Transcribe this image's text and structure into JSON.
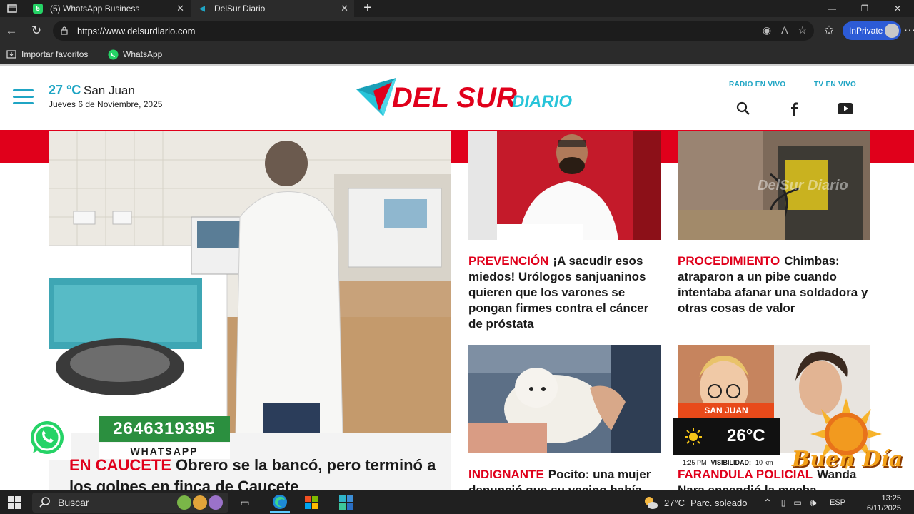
{
  "browser": {
    "tabs": [
      {
        "label": "(5) WhatsApp Business",
        "active": false
      },
      {
        "label": "DelSur Diario",
        "active": true
      }
    ],
    "new_tab": "+",
    "url": "https://www.delsurdiario.com",
    "inprivate_label": "InPrivate",
    "favorites": [
      {
        "label": "Importar favoritos",
        "icon": "import-icon"
      },
      {
        "label": "WhatsApp",
        "icon": "whatsapp-icon"
      }
    ]
  },
  "site": {
    "weather": {
      "temp": "27 °C",
      "city": "San Juan",
      "date": "Jueves 6 de Noviembre, 2025"
    },
    "logo": {
      "main": "DEL SUR",
      "sub": "DIARIO"
    },
    "links": {
      "radio": "RADIO EN VIVO",
      "tv": "TV EN VIVO"
    },
    "colors": {
      "accent": "#1fa5c4",
      "brand_red": "#e0001b",
      "whatsapp_green": "#2b8f3f"
    },
    "main_story": {
      "kicker": "EN CAUCETE",
      "headline": "Obrero se la bancó, pero terminó a los golpes en finca de Caucete"
    },
    "cards": [
      {
        "kicker": "PREVENCIÓN",
        "headline": "¡A sacudir esos miedos! Urólogos sanjuaninos quieren que los varones se pongan firmes contra el cáncer de próstata"
      },
      {
        "kicker": "PROCEDIMIENTO",
        "headline": "Chimbas: atraparon a un pibe cuando intentaba afanar una soldadora y otras cosas de valor"
      },
      {
        "kicker": "INDIGNANTE",
        "headline": "Pocito: una mujer denunció que su vecino había..."
      },
      {
        "kicker": "FARANDULA POLICIAL",
        "headline": "Wanda Nara encendió la mecha judicial..."
      }
    ],
    "whatsapp_widget": {
      "number": "2646319395",
      "label": "WHATSAPP"
    },
    "weather_widget": {
      "city": "SAN JUAN",
      "temp": "26°C",
      "time": "1:25 PM",
      "visibility_label": "VISIBILIDAD:",
      "visibility_value": "10 km"
    },
    "buen_dia": "Buen Día",
    "image_watermark": "DelSur Diario"
  },
  "taskbar": {
    "search_placeholder": "Buscar",
    "weather": "27°C",
    "weather_desc": "Parc. soleado",
    "lang": "ESP",
    "time": "13:25",
    "date": "6/11/2025"
  }
}
